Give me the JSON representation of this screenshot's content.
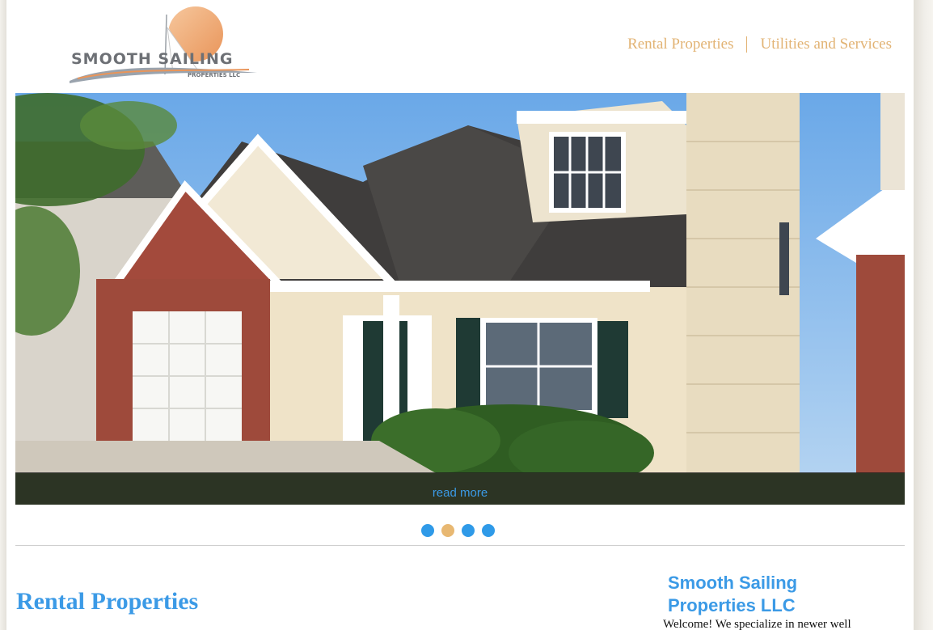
{
  "header": {
    "logo": {
      "brand_line": "SMOOTH SAILING",
      "sub_line": "PROPERTIES LLC"
    },
    "nav": [
      {
        "label": "Rental Properties"
      },
      {
        "label": "Utilities and Services"
      }
    ],
    "nav_color": "#e2b374"
  },
  "slider": {
    "read_more_label": "read more",
    "dots": [
      {
        "active": false,
        "color": "#2f9ae8"
      },
      {
        "active": true,
        "color": "#e8b872"
      },
      {
        "active": false,
        "color": "#2f9ae8"
      },
      {
        "active": false,
        "color": "#2f9ae8"
      }
    ]
  },
  "main": {
    "heading": "Rental Properties"
  },
  "sidebar": {
    "title": "Smooth Sailing Properties LLC",
    "intro": "Welcome! We specialize in newer well"
  },
  "colors": {
    "accent_blue": "#3b9ae6",
    "accent_gold": "#e2b374"
  }
}
